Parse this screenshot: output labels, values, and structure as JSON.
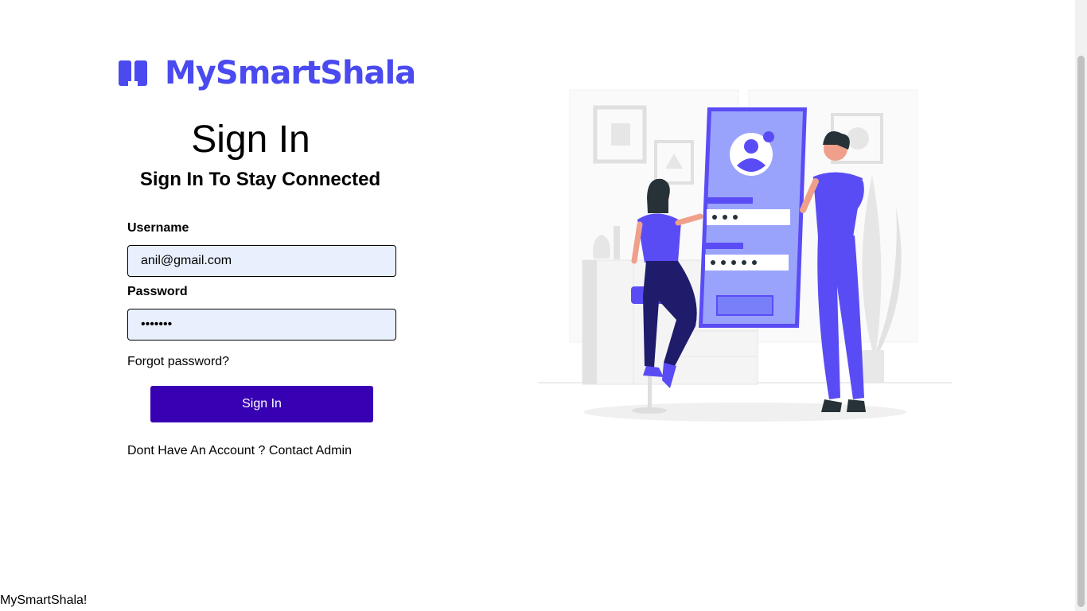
{
  "brand": {
    "name": "MySmartShala",
    "color": "#4a4af0"
  },
  "form": {
    "title": "Sign In",
    "subtitle": "Sign In To Stay Connected",
    "username_label": "Username",
    "username_value": "anil@gmail.com",
    "password_label": "Password",
    "password_value": "1234567",
    "forgot_link": "Forgot password?",
    "submit_label": "Sign In",
    "account_prefix": "Dont Have An Account ?",
    "contact_link": "Contact Admin"
  },
  "footer": {
    "text": "MySmartShala!"
  },
  "colors": {
    "accent": "#3700b3",
    "input_bg": "#e8f0fe",
    "illustration_primary": "#5a4cf5"
  },
  "icons": {
    "logo": "open-book-icon"
  }
}
